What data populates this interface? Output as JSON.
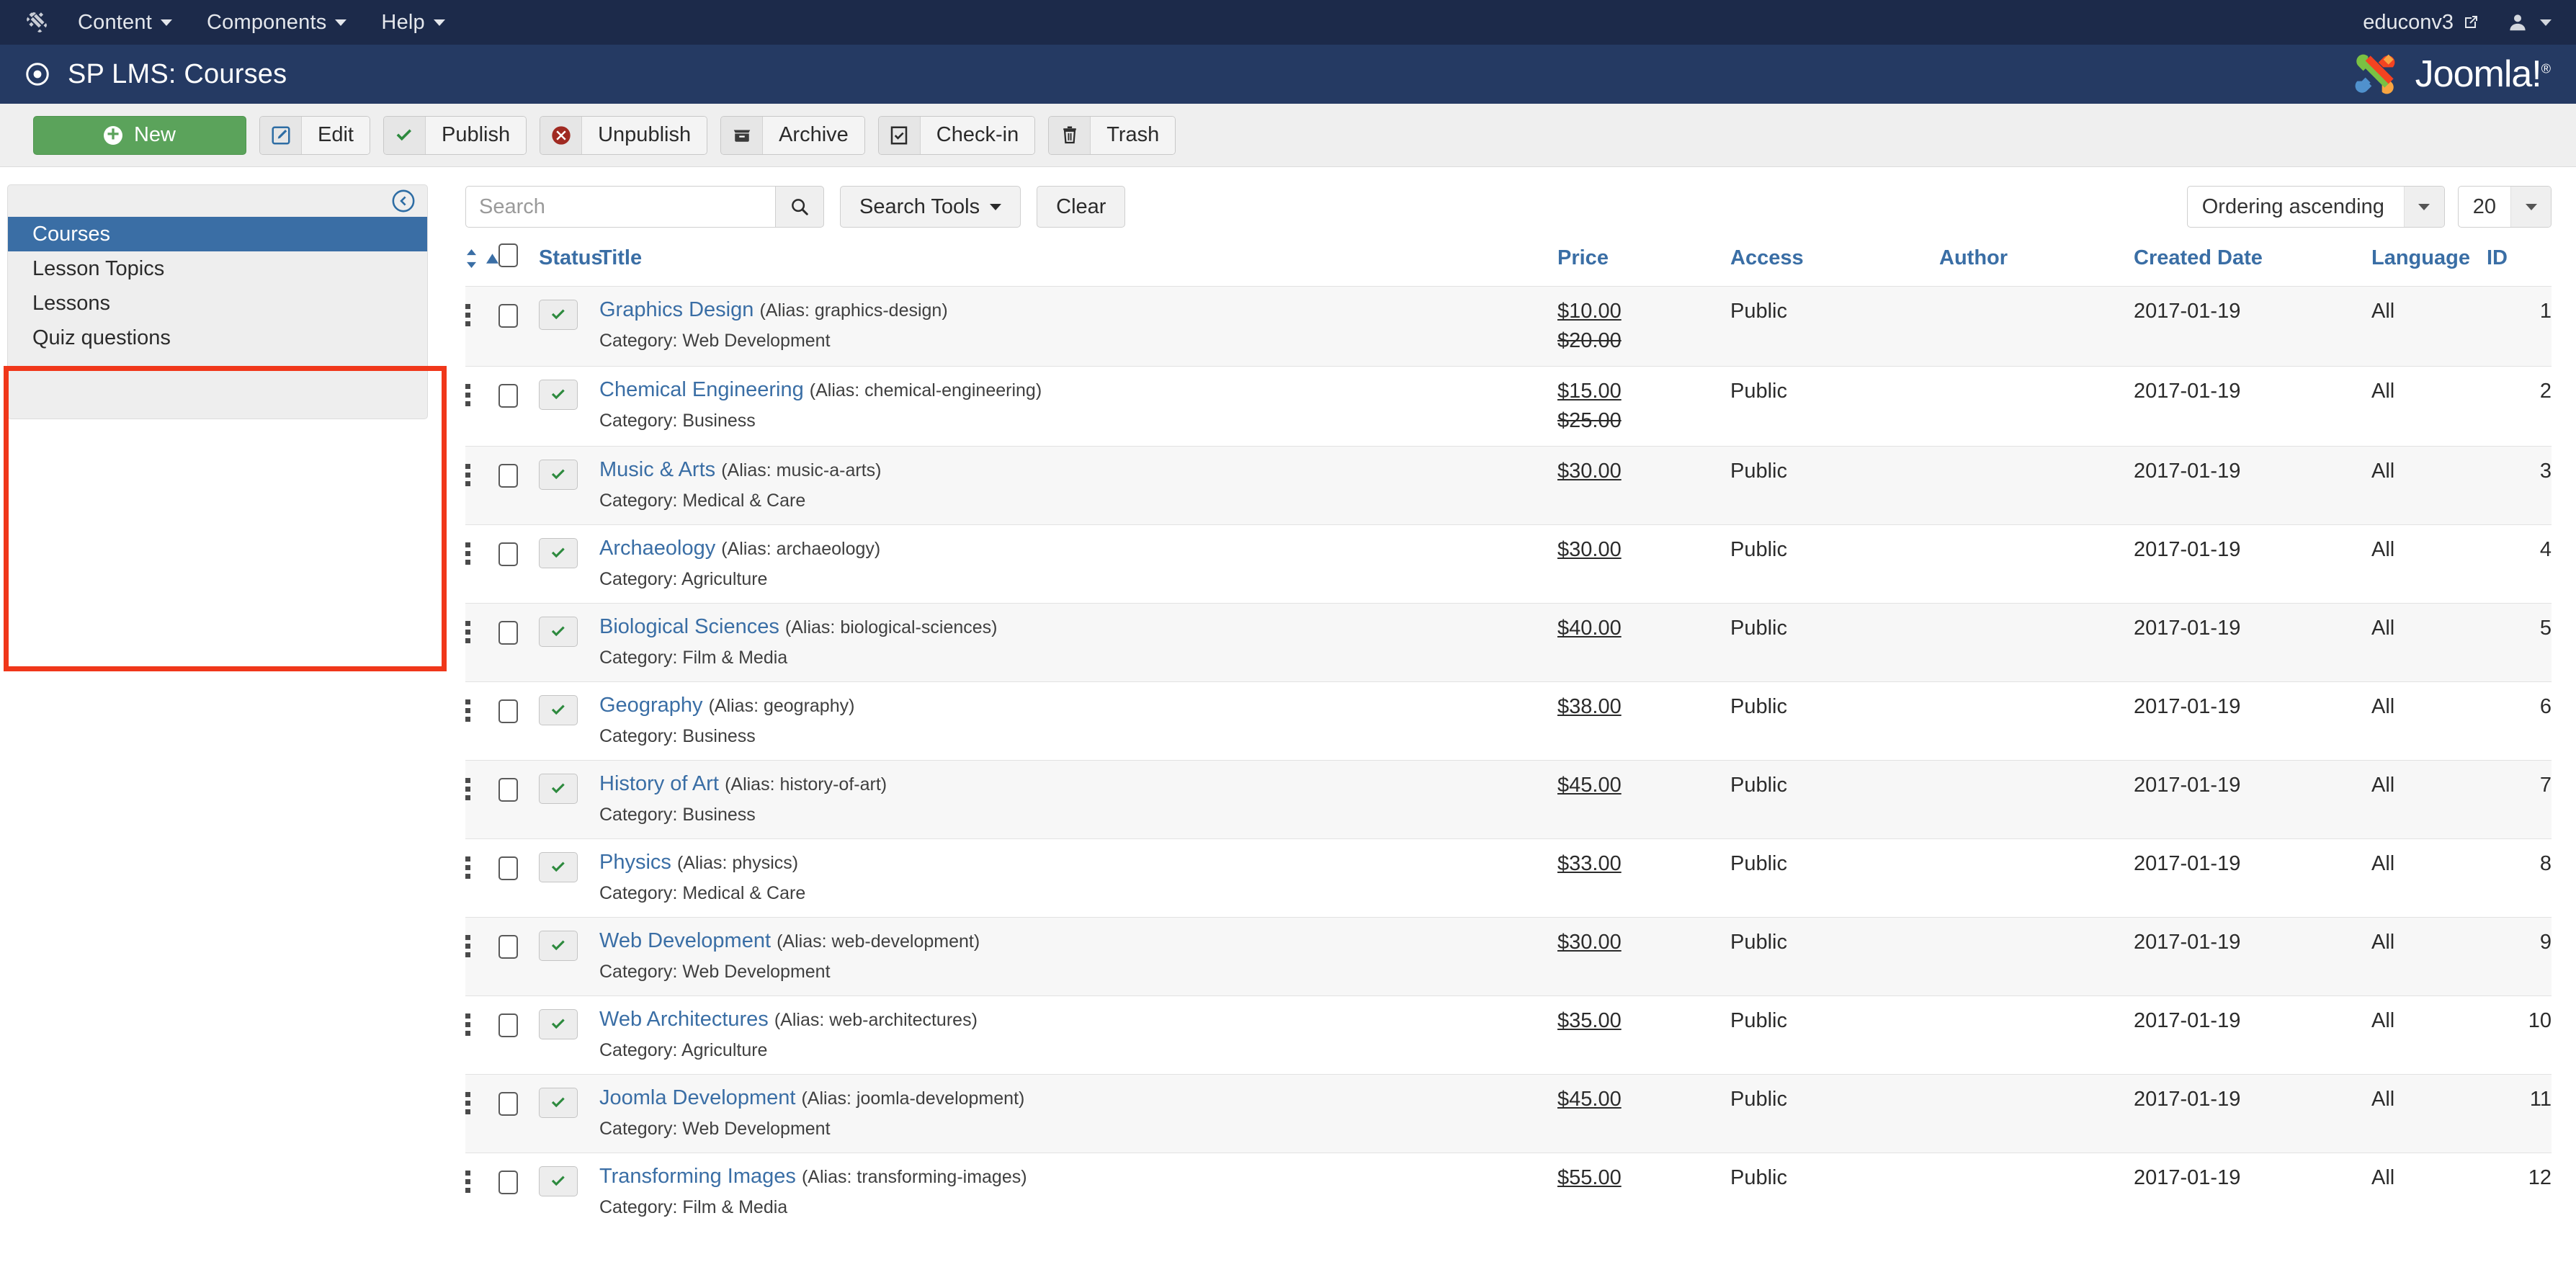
{
  "topnav": {
    "brand_icon": "joomla-mark-icon",
    "items": [
      {
        "label": "Content",
        "has_caret": true
      },
      {
        "label": "Components",
        "has_caret": true
      },
      {
        "label": "Help",
        "has_caret": true
      }
    ],
    "site_name": "educonv3",
    "external_icon": "external-link-icon",
    "user_icon": "user-icon",
    "user_caret_icon": "chevron-down-icon"
  },
  "subhead": {
    "title_icon": "target-circle-icon",
    "title": "SP LMS: Courses",
    "logo_text": "Joomla!",
    "logo_registered": "®"
  },
  "toolbar": {
    "new_label": "New",
    "new_icon": "plus-circle-icon",
    "buttons": [
      {
        "label": "Edit",
        "icon": "pencil-square-icon"
      },
      {
        "label": "Publish",
        "icon": "check-icon"
      },
      {
        "label": "Unpublish",
        "icon": "times-circle-icon"
      },
      {
        "label": "Archive",
        "icon": "archive-box-icon"
      },
      {
        "label": "Check-in",
        "icon": "checkbox-checked-icon"
      },
      {
        "label": "Trash",
        "icon": "trash-icon"
      }
    ]
  },
  "sidebar": {
    "collapse_icon": "arrow-circle-left-icon",
    "items": [
      {
        "label": "Courses",
        "active": true
      },
      {
        "label": "Lesson Topics",
        "active": false
      },
      {
        "label": "Lessons",
        "active": false
      },
      {
        "label": "Quiz questions",
        "active": false
      }
    ],
    "annotation_color": "#f0371a"
  },
  "filters": {
    "search_placeholder": "Search",
    "search_value": "",
    "search_icon": "search-icon",
    "search_tools_label": "Search Tools",
    "search_tools_caret": "caret-down-icon",
    "clear_label": "Clear",
    "ordering_value": "Ordering ascending",
    "limit_value": "20",
    "ordering_caret": "caret-down-icon",
    "limit_caret": "caret-down-icon"
  },
  "table": {
    "headers": {
      "sort": "sort-icon",
      "sort_asc": "caret-up-icon",
      "checkall": "select-all-checkbox",
      "status": "Status",
      "title": "Title",
      "price": "Price",
      "access": "Access",
      "author": "Author",
      "created_date": "Created Date",
      "language": "Language",
      "id": "ID"
    },
    "alias_prefix": "(Alias: ",
    "alias_suffix": ")",
    "category_prefix": "Category: ",
    "rows": [
      {
        "title": "Graphics Design",
        "alias": "graphics-design",
        "category": "Web Development",
        "price": "$10.00",
        "price_old": "$20.00",
        "access": "Public",
        "author": "",
        "created": "2017-01-19",
        "language": "All",
        "id": "1",
        "status": "published"
      },
      {
        "title": "Chemical Engineering",
        "alias": "chemical-engineering",
        "category": "Business",
        "price": "$15.00",
        "price_old": "$25.00",
        "access": "Public",
        "author": "",
        "created": "2017-01-19",
        "language": "All",
        "id": "2",
        "status": "published"
      },
      {
        "title": "Music & Arts",
        "alias": "music-a-arts",
        "category": "Medical & Care",
        "price": "$30.00",
        "price_old": "",
        "access": "Public",
        "author": "",
        "created": "2017-01-19",
        "language": "All",
        "id": "3",
        "status": "published"
      },
      {
        "title": "Archaeology",
        "alias": "archaeology",
        "category": "Agriculture",
        "price": "$30.00",
        "price_old": "",
        "access": "Public",
        "author": "",
        "created": "2017-01-19",
        "language": "All",
        "id": "4",
        "status": "published"
      },
      {
        "title": "Biological Sciences",
        "alias": "biological-sciences",
        "category": "Film & Media",
        "price": "$40.00",
        "price_old": "",
        "access": "Public",
        "author": "",
        "created": "2017-01-19",
        "language": "All",
        "id": "5",
        "status": "published"
      },
      {
        "title": "Geography",
        "alias": "geography",
        "category": "Business",
        "price": "$38.00",
        "price_old": "",
        "access": "Public",
        "author": "",
        "created": "2017-01-19",
        "language": "All",
        "id": "6",
        "status": "published"
      },
      {
        "title": "History of Art",
        "alias": "history-of-art",
        "category": "Business",
        "price": "$45.00",
        "price_old": "",
        "access": "Public",
        "author": "",
        "created": "2017-01-19",
        "language": "All",
        "id": "7",
        "status": "published"
      },
      {
        "title": "Physics",
        "alias": "physics",
        "category": "Medical & Care",
        "price": "$33.00",
        "price_old": "",
        "access": "Public",
        "author": "",
        "created": "2017-01-19",
        "language": "All",
        "id": "8",
        "status": "published"
      },
      {
        "title": "Web Development",
        "alias": "web-development",
        "category": "Web Development",
        "price": "$30.00",
        "price_old": "",
        "access": "Public",
        "author": "",
        "created": "2017-01-19",
        "language": "All",
        "id": "9",
        "status": "published"
      },
      {
        "title": "Web Architectures",
        "alias": "web-architectures",
        "category": "Agriculture",
        "price": "$35.00",
        "price_old": "",
        "access": "Public",
        "author": "",
        "created": "2017-01-19",
        "language": "All",
        "id": "10",
        "status": "published"
      },
      {
        "title": "Joomla Development",
        "alias": "joomla-development",
        "category": "Web Development",
        "price": "$45.00",
        "price_old": "",
        "access": "Public",
        "author": "",
        "created": "2017-01-19",
        "language": "All",
        "id": "11",
        "status": "published"
      },
      {
        "title": "Transforming Images",
        "alias": "transforming-images",
        "category": "Film & Media",
        "price": "$55.00",
        "price_old": "",
        "access": "Public",
        "author": "",
        "created": "2017-01-19",
        "language": "All",
        "id": "12",
        "status": "published"
      }
    ]
  },
  "colors": {
    "topnav_bg": "#1c2a4a",
    "subhead_bg": "#253a63",
    "accent_blue": "#3a6ea5",
    "new_green": "#5ba35b",
    "unpublish_red": "#a02a22",
    "annotation_red": "#f0371a"
  }
}
